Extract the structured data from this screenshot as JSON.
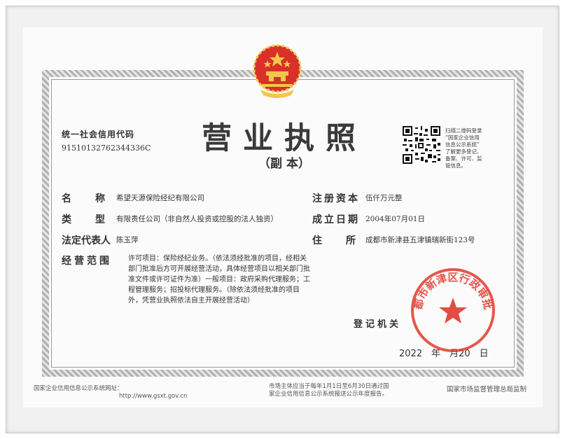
{
  "license": {
    "title": "营业执照",
    "subtitle": "（副 本）",
    "credit_code_label": "统一社会信用代码",
    "credit_code": "91510132762344336C",
    "qr_text": [
      "扫描二维码登录",
      "“国家企业信用",
      "信息公示系统”",
      "了解更多登记、",
      "备案、许可、监",
      "管信息。"
    ],
    "fields": {
      "name_label": "名　　称",
      "name": "希望天源保险经纪有限公司",
      "type_label": "类　　型",
      "type": "有限责任公司（非自然人投资或控股的法人独资）",
      "rep_label": "法定代表人",
      "rep": "陈玉萍",
      "scope_label": "经营范围",
      "scope": "许可项目：保险经纪业务。（依法须经批准的项目，经相关部门批准后方可开展经营活动，具体经营项目以相关部门批准文件或许可证件为准）一般项目：政府采购代理服务；工程管理服务；招投标代理服务。（除依法须经批准的项目外，凭营业执照依法自主开展经营活动）",
      "capital_label": "注册资本",
      "capital": "伍仟万元整",
      "date_label": "成立日期",
      "established": "2004年07月01日",
      "address_label": "住　　所",
      "address": "成都市新津县五津镇瑞新街123号"
    },
    "registrar_label": "登记机关",
    "issue_date": "2022　年　月20　日",
    "seal_text": "成都市新津区行政审批局",
    "footer_left": "国家企业信用信息公示系统网址：",
    "footer_url": "http://www.gsxt.gov.cn",
    "footer_mid": [
      "市场主体应当于每年1月1日至6月30日通过国",
      "家企业信用信息公示系统报送公示年度报告。"
    ],
    "footer_right": "国家市场监督管理总局监制"
  },
  "colors": {
    "seal_red": "#e03a2c",
    "emblem_red": "#d9302a",
    "emblem_gold": "#f2c84b"
  }
}
